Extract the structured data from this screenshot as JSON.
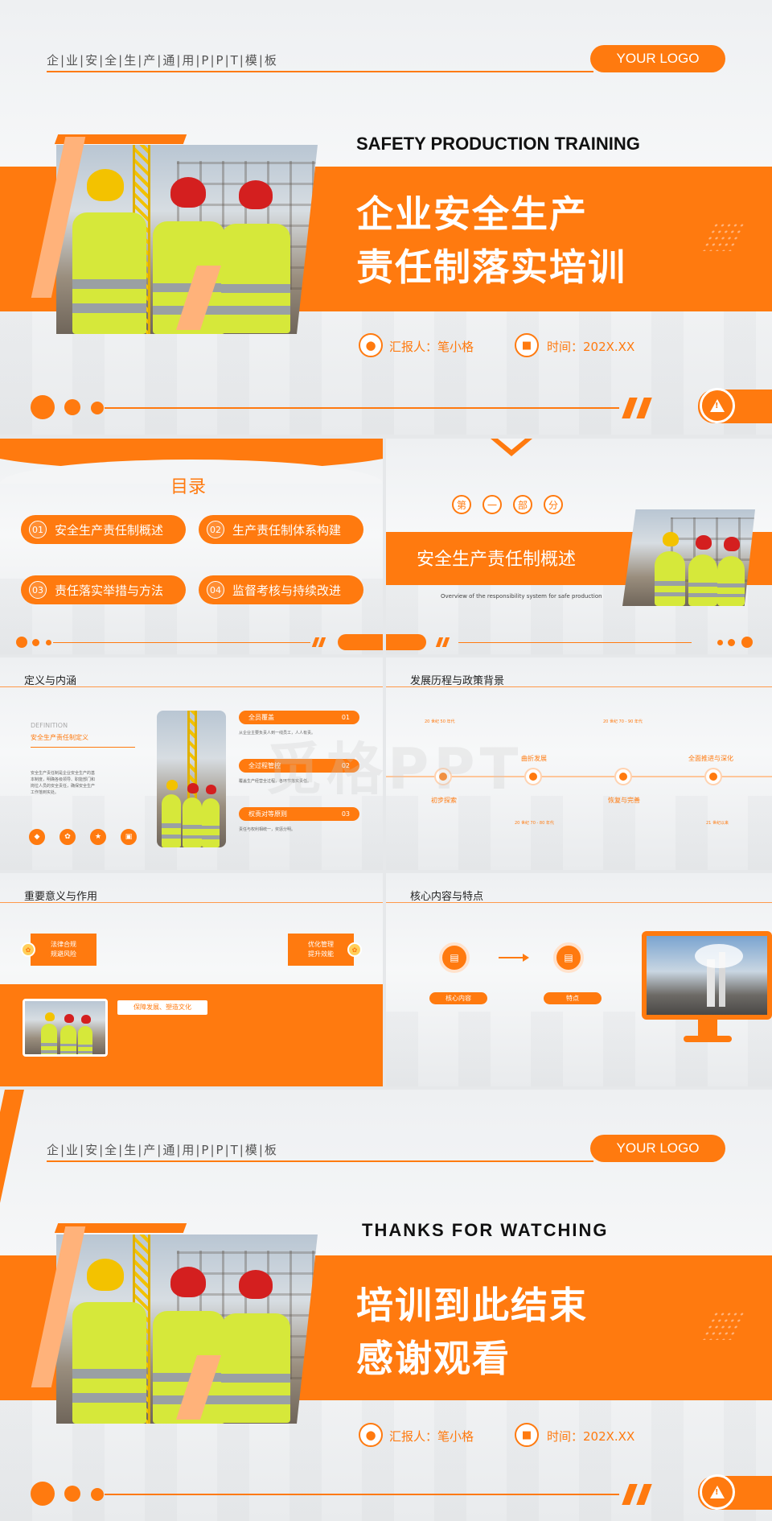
{
  "cover": {
    "tagline": "企|业|安|全|生|产|通|用|P|P|T|模|板",
    "logo": "YOUR LOGO",
    "english_title": "SAFETY PRODUCTION TRAINING",
    "title_line1": "企业安全生产",
    "title_line2": "责任制落实培训",
    "reporter": "汇报人：笔小格",
    "time": "时间：202X.XX"
  },
  "toc": {
    "title": "目录",
    "items": [
      {
        "num": "01",
        "label": "安全生产责任制概述"
      },
      {
        "num": "02",
        "label": "生产责任制体系构建"
      },
      {
        "num": "03",
        "label": "责任落实举措与方法"
      },
      {
        "num": "04",
        "label": "监督考核与持续改进"
      }
    ]
  },
  "part": {
    "chars": [
      "第",
      "一",
      "部",
      "分"
    ],
    "title": "安全生产责任制概述",
    "subtitle": "Overview of the responsibility system for safe production"
  },
  "definition": {
    "title": "定义与内涵",
    "label_en": "DEFINITION",
    "label_cn": "安全生产责任制定义",
    "body": "安全生产责任制是企业安全生产的基本制度，明确各级领导、职能部门和岗位人员的安全责任，确保安全生产工作落到实处。",
    "pills": [
      {
        "label": "全员覆盖",
        "num": "01"
      },
      {
        "label": "全过程管控",
        "num": "02"
      },
      {
        "label": "权责对等原则",
        "num": "03"
      }
    ],
    "pill_texts": [
      "从企业主要负责人到一线员工，人人有责。",
      "覆盖生产经营全过程，各环节落实责任。",
      "责任与权利相统一，奖惩分明。"
    ]
  },
  "history": {
    "title": "发展历程与政策背景",
    "stages": [
      {
        "name": "初步探索",
        "period": "20 世纪 50 年代"
      },
      {
        "name": "曲折发展",
        "period": "20 世纪 70 - 80 年代"
      },
      {
        "name": "恢复与完善",
        "period": "20 世纪 70 - 90 年代"
      },
      {
        "name": "全面推进与深化",
        "period": "21 世纪以来"
      }
    ]
  },
  "significance": {
    "title": "重要意义与作用",
    "left_tag_line1": "法律合规",
    "left_tag_line2": "规避风险",
    "right_tag_line1": "优化管理",
    "right_tag_line2": "提升效能",
    "banner": "保障发展、塑造文化"
  },
  "core": {
    "title": "核心内容与特点",
    "labels": [
      "核心内容",
      "特点"
    ]
  },
  "ending": {
    "tagline": "企|业|安|全|生|产|通|用|P|P|T|模|板",
    "logo": "YOUR LOGO",
    "english_title": "THANKS FOR WATCHING",
    "title_line1": "培训到此结束",
    "title_line2": "感谢观看",
    "reporter": "汇报人：笔小格",
    "time": "时间：202X.XX"
  },
  "watermark": "觅格PPT",
  "colors": {
    "accent": "#ff7a0f",
    "accent_light": "#ffb27a"
  }
}
